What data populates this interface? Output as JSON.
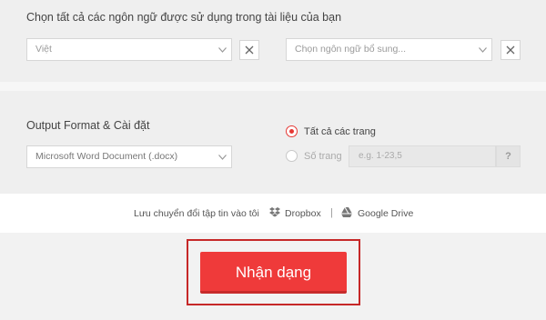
{
  "languages": {
    "title": "Chọn tất cả các ngôn ngữ được sử dụng trong tài liệu của bạn",
    "primary_value": "Việt",
    "secondary_placeholder": "Chọn ngôn ngữ bổ sung..."
  },
  "output": {
    "title": "Output Format & Cài đặt",
    "format_value": "Microsoft Word Document (.docx)",
    "all_pages_label": "Tất cả các trang",
    "page_number_label": "Số trang",
    "page_number_placeholder": "e.g. 1-23,5",
    "help_label": "?"
  },
  "transfer": {
    "label": "Lưu chuyển đổi tập tin vào tôi",
    "dropbox_label": "Dropbox",
    "separator": "|",
    "gdrive_label": "Google Drive"
  },
  "action": {
    "recognize_label": "Nhận dạng"
  },
  "colors": {
    "accent": "#ef3a3a",
    "highlight_border": "#c62828"
  }
}
